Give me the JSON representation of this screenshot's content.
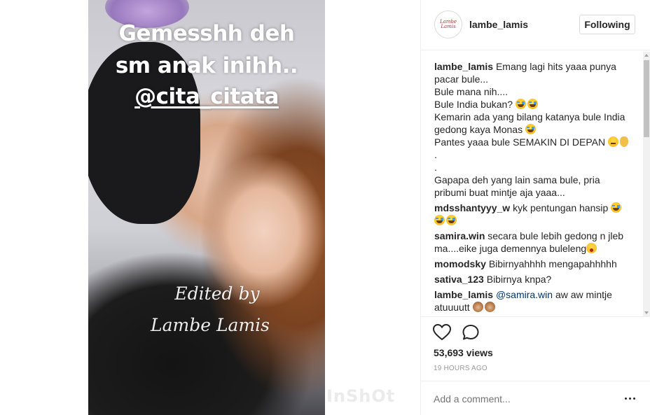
{
  "post": {
    "author": "lambe_lamis",
    "follow_label": "Following",
    "avatar_logo_text": "Lambe Lamis",
    "views": "53,693 views",
    "time": "19 HOURS AGO",
    "add_comment_placeholder": "Add a comment..."
  },
  "story": {
    "line1": "Gemesshh deh",
    "line2": "sm anak inihh..",
    "line3": "@cita_citata",
    "edited_line1": "Edited by",
    "edited_line2": "Lambe Lamis",
    "inshot": "InShOt"
  },
  "caption": {
    "user": "lambe_lamis",
    "lines": [
      "Emang lagi hits yaaa punya",
      "pacar bule...",
      "Bule mana nih....",
      "Bule India bukan?",
      "Kemarin ada yang bilang katanya bule India",
      "gedong kaya Monas",
      "Pantes yaaa bule SEMAKIN DI DEPAN",
      ".",
      ".",
      "Gapapa deh yang lain sama bule, pria",
      "pribumi buat mintje aja yaaa..."
    ]
  },
  "comments": [
    {
      "user": "mdsshantyyy_w",
      "text": "kyk pentungan hansip"
    },
    {
      "user": "samira.win",
      "text1": "secara bule lebih gedong n jleb",
      "text2": "ma....eike juga demennya buleleng"
    },
    {
      "user": "momodsky",
      "text": "Bibirnyahhhh mengapahhhhh"
    },
    {
      "user": "sativa_123",
      "text": "Bibirnya knpa?"
    },
    {
      "user": "lambe_lamis",
      "mention": "@samira.win",
      "text1": "aw aw mintje",
      "text2": "atuuuutt"
    }
  ],
  "icons": {
    "like": "heart-icon",
    "comment": "comment-bubble-icon",
    "more": "more-options-icon"
  },
  "colors": {
    "text": "#262626",
    "muted": "#999999",
    "link": "#003569",
    "border": "#dbdbdb"
  }
}
